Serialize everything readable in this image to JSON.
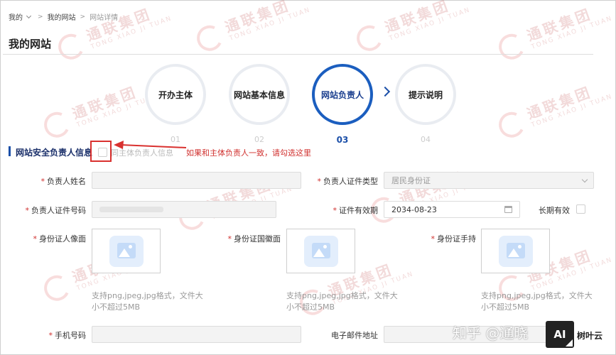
{
  "breadcrumb": {
    "home": "我的",
    "site": "我的网站",
    "detail": "网站详情"
  },
  "page": {
    "title": "我的网站"
  },
  "steps": [
    {
      "label": "开办主体",
      "num": "01"
    },
    {
      "label": "网站基本信息",
      "num": "02"
    },
    {
      "label": "网站负责人",
      "num": "03"
    },
    {
      "label": "提示说明",
      "num": "04"
    }
  ],
  "active_step": 3,
  "section": {
    "title": "网站安全负责人信息",
    "same_as_owner": "同主体负责人信息",
    "annotation": "如果和主体负责人一致，请勾选这里"
  },
  "form": {
    "name_label": "负责人姓名",
    "id_type_label": "负责人证件类型",
    "id_type_value": "居民身份证",
    "id_no_label": "负责人证件号码",
    "expiry_label": "证件有效期",
    "expiry_value": "2034-08-23",
    "long_term_label": "长期有效",
    "id_front_label": "身份证人像面",
    "id_back_label": "身份证国徽面",
    "id_hand_label": "身份证手持",
    "upload_hint_1": "支持png,jpeg,jpg格式，文件大",
    "upload_hint_2": "小不超过5MB",
    "phone_label": "手机号码",
    "email_label": "电子邮件地址"
  },
  "watermark": {
    "text": "通联集团",
    "sub": "TONG XIAO JI TUAN"
  },
  "overlay": {
    "zhihu": "知乎 @通晓",
    "brand": "树叶云",
    "ai": "AI"
  },
  "colors": {
    "accent": "#1b5ebf",
    "alert": "#d9312f"
  }
}
